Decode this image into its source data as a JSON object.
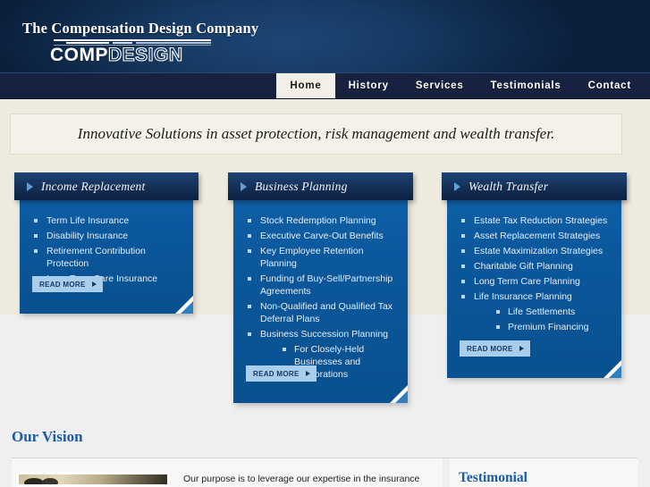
{
  "header": {
    "company_name": "The Compensation Design Company",
    "logo": {
      "part1": "COMP",
      "part2": "DESIGN"
    }
  },
  "nav": {
    "items": [
      {
        "label": "Home",
        "active": true
      },
      {
        "label": "History",
        "active": false
      },
      {
        "label": "Services",
        "active": false
      },
      {
        "label": "Testimonials",
        "active": false
      },
      {
        "label": "Contact",
        "active": false
      }
    ]
  },
  "tagline": {
    "text": "Innovative Solutions in asset protection, risk management and wealth transfer."
  },
  "cards": [
    {
      "title": "Income Replacement",
      "items": [
        {
          "text": "Term Life Insurance"
        },
        {
          "text": "Disability Insurance"
        },
        {
          "text": "Retirement Contribution Protection"
        },
        {
          "text": "Long Term Care Insurance"
        }
      ],
      "read_more": "READ MORE"
    },
    {
      "title": "Business Planning",
      "items": [
        {
          "text": "Stock Redemption Planning"
        },
        {
          "text": "Executive Carve-Out Benefits"
        },
        {
          "text": "Key Employee Retention Planning"
        },
        {
          "text": "Funding of Buy-Sell/Partnership Agreements"
        },
        {
          "text": "Non-Qualified and Qualified Tax Deferral Plans"
        },
        {
          "text": "Business Succession Planning",
          "subitems": [
            "For Closely-Held Businesses and Corporations"
          ]
        }
      ],
      "read_more": "READ MORE"
    },
    {
      "title": "Wealth Transfer",
      "items": [
        {
          "text": "Estate Tax Reduction Strategies"
        },
        {
          "text": "Asset Replacement Strategies"
        },
        {
          "text": "Estate Maximization Strategies"
        },
        {
          "text": "Charitable Gift Planning"
        },
        {
          "text": "Long Term Care Planning"
        },
        {
          "text": "Life Insurance Planning",
          "subitems": [
            "Life Settlements",
            "Premium Financing"
          ]
        }
      ],
      "read_more": "READ MORE"
    }
  ],
  "vision": {
    "heading": "Our Vision",
    "body": "Our purpose is to leverage our expertise in the insurance"
  },
  "testimonial": {
    "heading": "Testimonial"
  },
  "colors": {
    "header_navy": "#0c1f3c",
    "nav_bar": "#16223f",
    "card_blue": "#0b589d",
    "card_head_navy": "#142f55",
    "accent_blue": "#1b5ba6",
    "button_blue": "#a9cdea",
    "beige": "#eeeade",
    "gray": "#efefef"
  }
}
